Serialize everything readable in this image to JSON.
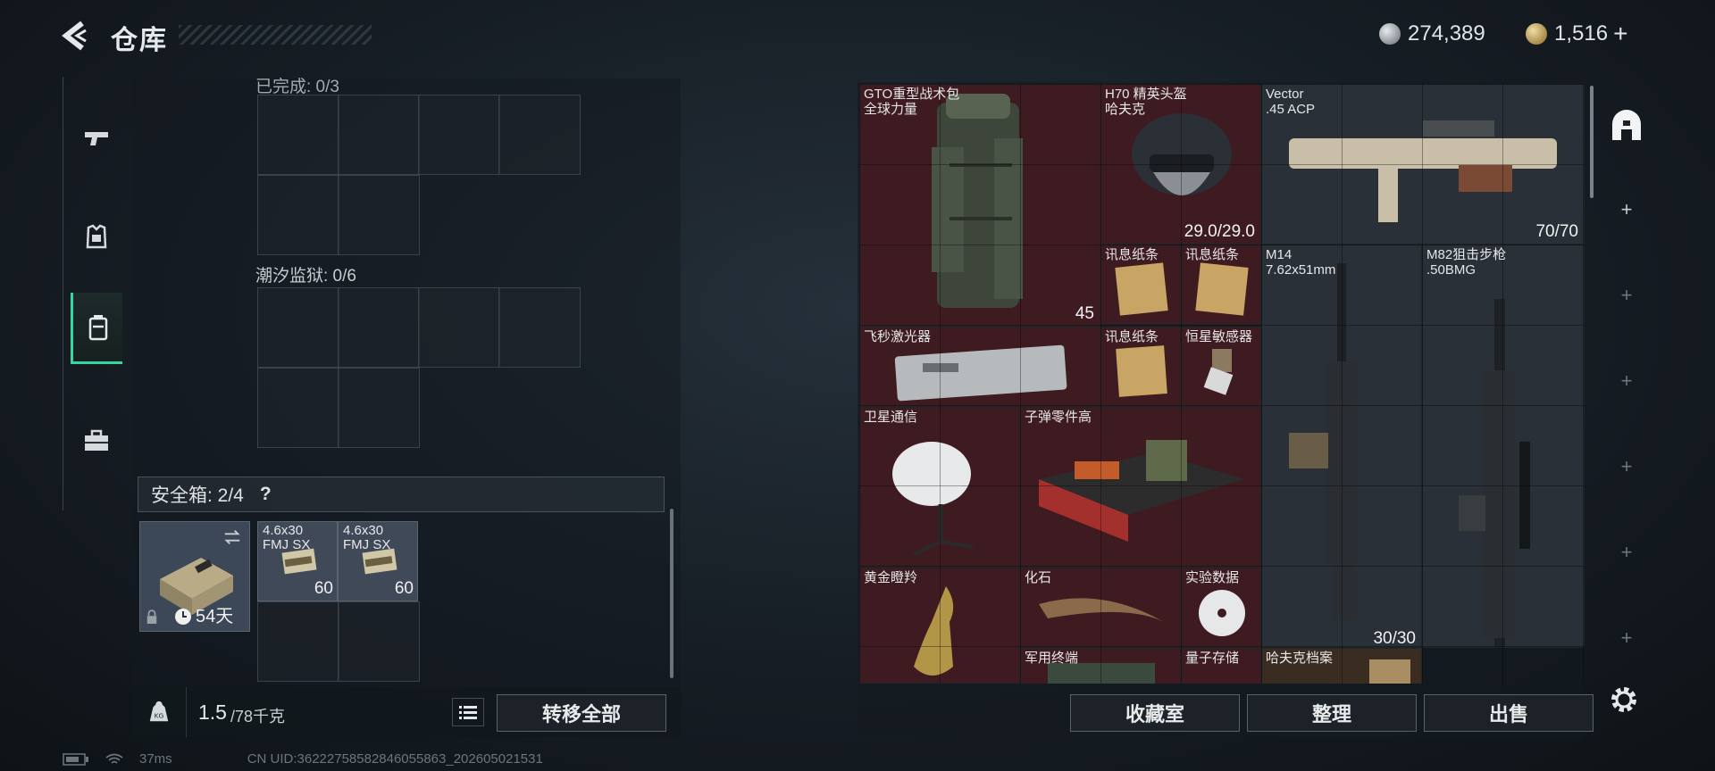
{
  "header": {
    "title": "仓库",
    "silver": "274,389",
    "gold": "1,516",
    "gold_add": "+"
  },
  "left_panel": {
    "top_section_label": "已完成: 0/3",
    "section2_label": "潮汐监狱: 0/6",
    "safebox_label": "安全箱: 2/4",
    "safebox_help": "?",
    "safebox_days": "54天",
    "safebox_items": [
      {
        "name": "4.6x30\nFMJ SX",
        "count": "60"
      },
      {
        "name": "4.6x30\nFMJ SX",
        "count": "60"
      }
    ],
    "weight_value": "1.5",
    "weight_limit": "/78千克",
    "transfer_all": "转移全部"
  },
  "inventory": {
    "items": [
      {
        "id": "gto-backpack",
        "name": "GTO重型战术包\n全球力量",
        "count": "45",
        "bg": "#3e1b20"
      },
      {
        "id": "h70-helmet",
        "name": "H70 精英头盔\n哈夫克",
        "count": "29.0/29.0",
        "bg": "#3e1b20"
      },
      {
        "id": "vector",
        "name": "Vector\n.45 ACP",
        "count": "70/70",
        "bg": "#2a3038"
      },
      {
        "id": "note1",
        "name": "讯息纸条",
        "count": "",
        "bg": "#3e1b20"
      },
      {
        "id": "note2",
        "name": "讯息纸条",
        "count": "",
        "bg": "#3e1b20"
      },
      {
        "id": "m14",
        "name": "M14\n7.62x51mm",
        "count": "30/30",
        "bg": "#2a3038"
      },
      {
        "id": "m82",
        "name": "M82狙击步枪\n.50BMG",
        "count": "",
        "bg": "#2a3038"
      },
      {
        "id": "laser",
        "name": "飞秒激光器",
        "count": "",
        "bg": "#3e1b20"
      },
      {
        "id": "note3",
        "name": "讯息纸条",
        "count": "",
        "bg": "#3e1b20"
      },
      {
        "id": "sensor",
        "name": "恒星敏感器",
        "count": "",
        "bg": "#3e1b20"
      },
      {
        "id": "satellite",
        "name": "卫星通信",
        "count": "",
        "bg": "#3e1b20"
      },
      {
        "id": "ammo-parts",
        "name": "子弹零件高",
        "count": "",
        "bg": "#3e1b20"
      },
      {
        "id": "golden-antelope",
        "name": "黄金瞪羚",
        "count": "",
        "bg": "#3e1b20"
      },
      {
        "id": "fossil",
        "name": "化石",
        "count": "",
        "bg": "#3e1b20"
      },
      {
        "id": "exp-data",
        "name": "实验数据",
        "count": "",
        "bg": "#3e1b20"
      },
      {
        "id": "military-terminal",
        "name": "军用终端",
        "count": "",
        "bg": "#3e1b20"
      },
      {
        "id": "quantum-storage",
        "name": "量子存储",
        "count": "",
        "bg": "#3e1b20"
      },
      {
        "id": "havk-archive",
        "name": "哈夫克档案",
        "count": "",
        "bg": "#3b2c22"
      }
    ]
  },
  "bottom_buttons": {
    "collection": "收藏室",
    "organize": "整理",
    "sell": "出售"
  },
  "status_bar": {
    "ping": "37ms",
    "uid": "CN UID:3622275858284605586​3_202605021531"
  },
  "colors": {
    "accent": "#36d6a2",
    "rare_red": "#3e1b20",
    "common_gray": "#2a3038"
  }
}
